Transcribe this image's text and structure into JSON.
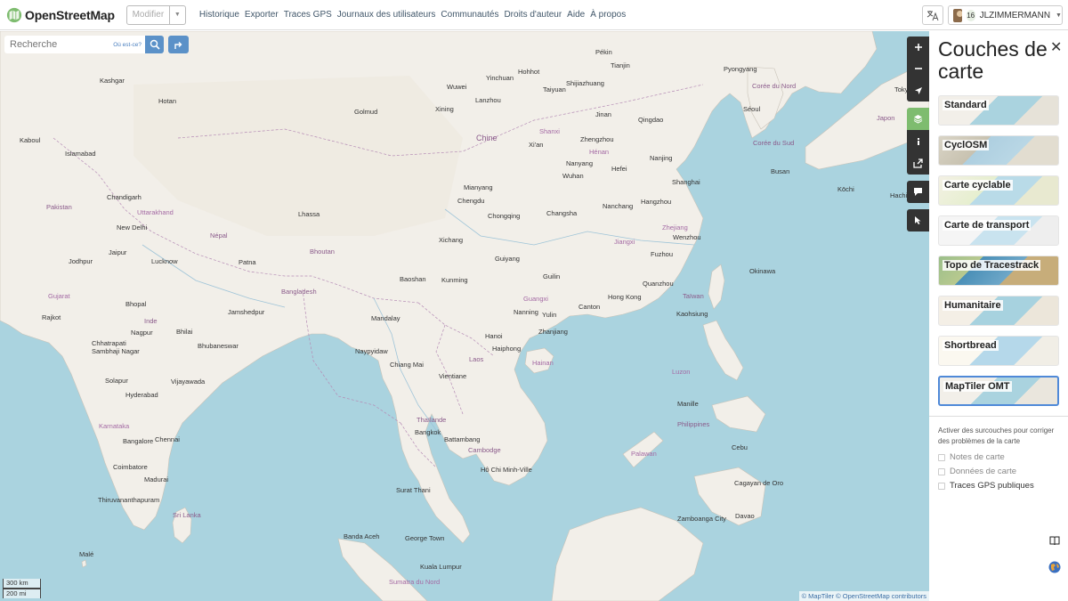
{
  "header": {
    "logo_text": "OpenStreetMap",
    "edit_label": "Modifier",
    "nav": [
      "Historique",
      "Exporter",
      "Traces GPS",
      "Journaux des utilisateurs",
      "Communautés",
      "Droits d'auteur",
      "Aide",
      "À propos"
    ],
    "user": {
      "badge": "16",
      "name": "JLZIMMERMANN"
    }
  },
  "search": {
    "placeholder": "Recherche",
    "where_link": "Où est-ce?"
  },
  "panel": {
    "title": "Couches de carte",
    "layers": [
      "Standard",
      "CyclOSM",
      "Carte cyclable",
      "Carte de transport",
      "Topo de Tracestrack",
      "Humanitaire",
      "Shortbread",
      "MapTiler OMT"
    ],
    "selected_layer": "MapTiler OMT",
    "overlay_hint": "Activer des surcouches pour corriger des problèmes de la carte",
    "overlays": [
      {
        "label": "Notes de carte",
        "enabled": false
      },
      {
        "label": "Données de carte",
        "enabled": false
      },
      {
        "label": "Traces GPS publiques",
        "enabled": true
      }
    ]
  },
  "map": {
    "scale_km": "300 km",
    "scale_mi": "200 mi",
    "attribution_maptiler": "© MapTiler",
    "attribution_osm": "© OpenStreetMap contributors",
    "places": [
      "Kashgar",
      "Hotan",
      "Kaboul",
      "Islamabad",
      "Pakistan",
      "Chandigarh",
      "New Delhi",
      "Uttarakhand",
      "Lhassa",
      "Népal",
      "Bhoutan",
      "Jodhpur",
      "Jaipur",
      "Lucknow",
      "Patna",
      "Bangladesh",
      "Gujarat",
      "Bhopal",
      "Inde",
      "Jamshedpur",
      "Rajkot",
      "Nagpur",
      "Bhilai",
      "Chhatrapati Sambhaji Nagar",
      "Bhubaneswar",
      "Solapur",
      "Hyderabad",
      "Vijayawada",
      "Karnataka",
      "Bangalore",
      "Chennai",
      "Coimbatore",
      "Madurai",
      "Thiruvananthapuram",
      "Sri Lanka",
      "Malé",
      "Chine",
      "Golmud",
      "Xining",
      "Lanzhou",
      "Wuwei",
      "Yinchuan",
      "Hohhot",
      "Pékin",
      "Tianjin",
      "Shanxi",
      "Shijiazhuang",
      "Taiyuan",
      "Jinan",
      "Qingdao",
      "Xi'an",
      "Hénan",
      "Zhengzhou",
      "Nanyang",
      "Hefei",
      "Nanjing",
      "Wuhan",
      "Mianyang",
      "Chengdu",
      "Chongqing",
      "Changsha",
      "Nanchang",
      "Hangzhou",
      "Zhejiang",
      "Wenzhou",
      "Jiangxi",
      "Xichang",
      "Guiyang",
      "Fuzhou",
      "Baoshan",
      "Kunming",
      "Guilin",
      "Quanzhou",
      "Nanning",
      "Guangxi",
      "Canton",
      "Hong Kong",
      "Kaohsiung",
      "Taïwan",
      "Yulin",
      "Zhanjiang",
      "Hainan",
      "Haiphong",
      "Hanoi",
      "Mandalay",
      "Naypyidaw",
      "Chiang Mai",
      "Vientiane",
      "Laos",
      "Thaïlande",
      "Bangkok",
      "Battambang",
      "Cambodge",
      "Hô Chi Minh-Ville",
      "Surat Thani",
      "Banda Aceh",
      "George Town",
      "Kuala Lumpur",
      "Sumatra du Nord",
      "Palawan",
      "Cagayan de Oro",
      "Davao",
      "Zamboanga City",
      "Cebu",
      "Philippines",
      "Luzon",
      "Manille",
      "Pyongyang",
      "Séoul",
      "Corée du Sud",
      "Corée du Nord",
      "Busan",
      "Kōchi",
      "Tokyo",
      "Japon",
      "Okinawa",
      "Hachijō",
      "Shanghai"
    ]
  }
}
